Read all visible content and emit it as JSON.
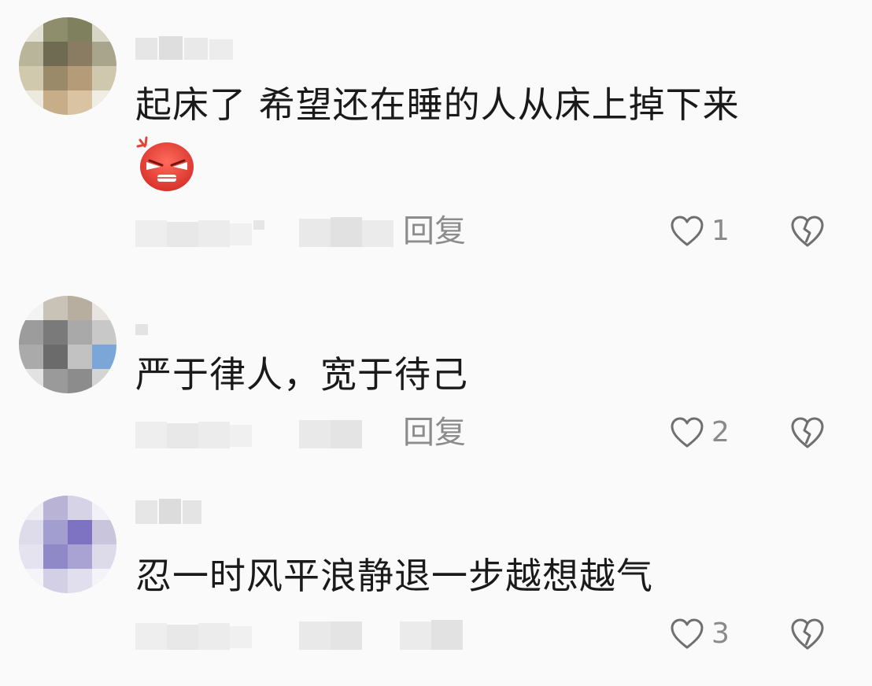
{
  "comments": [
    {
      "text": "起床了  希望还在睡的人从床上掉下来",
      "emoji": "angry-face-icon",
      "reply_label": "回复",
      "likes": "1"
    },
    {
      "text": "严于律人，宽于待己",
      "reply_label": "回复",
      "likes": "2"
    },
    {
      "text": "忍一时风平浪静退一步越想越气",
      "reply_label": "",
      "likes": "3"
    }
  ],
  "colors": {
    "text": "#1a1a1a",
    "meta": "#8c8c8c",
    "icon": "#6f6f6f",
    "emoji_red": "#e8413a"
  }
}
